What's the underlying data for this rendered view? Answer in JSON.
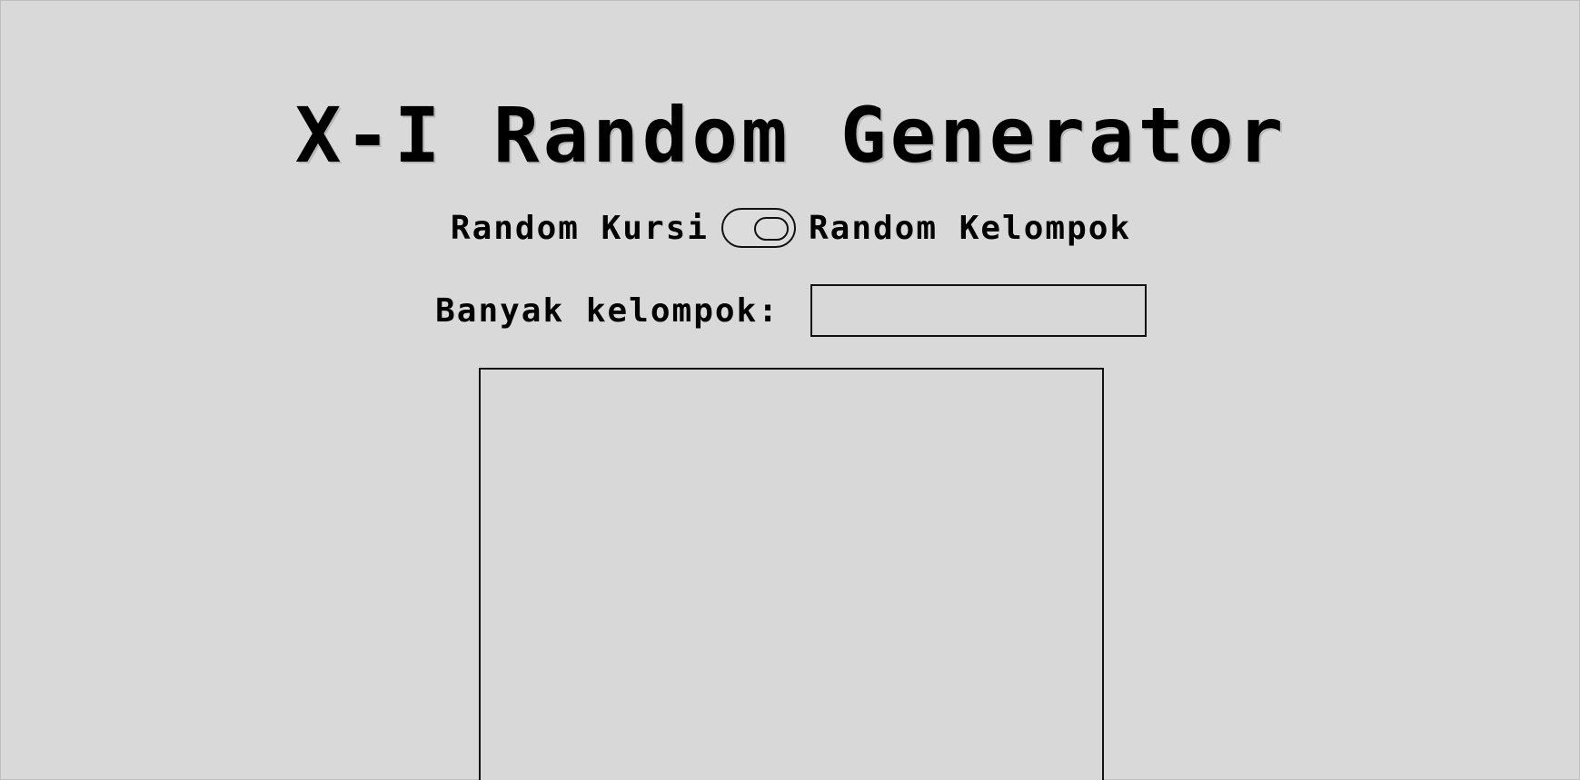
{
  "page": {
    "title": "X-I Random Generator"
  },
  "mode_toggle": {
    "left_label": "Random Kursi",
    "right_label": "Random Kelompok",
    "selected": "Random Kelompok"
  },
  "group_count": {
    "label": "Banyak kelompok:",
    "value": "",
    "placeholder": ""
  },
  "results": {
    "content": ""
  },
  "colors": {
    "background": "#d9d9d9",
    "border": "#111111",
    "text": "#000000"
  },
  "icons": {
    "toggle": "toggle-switch-icon"
  }
}
